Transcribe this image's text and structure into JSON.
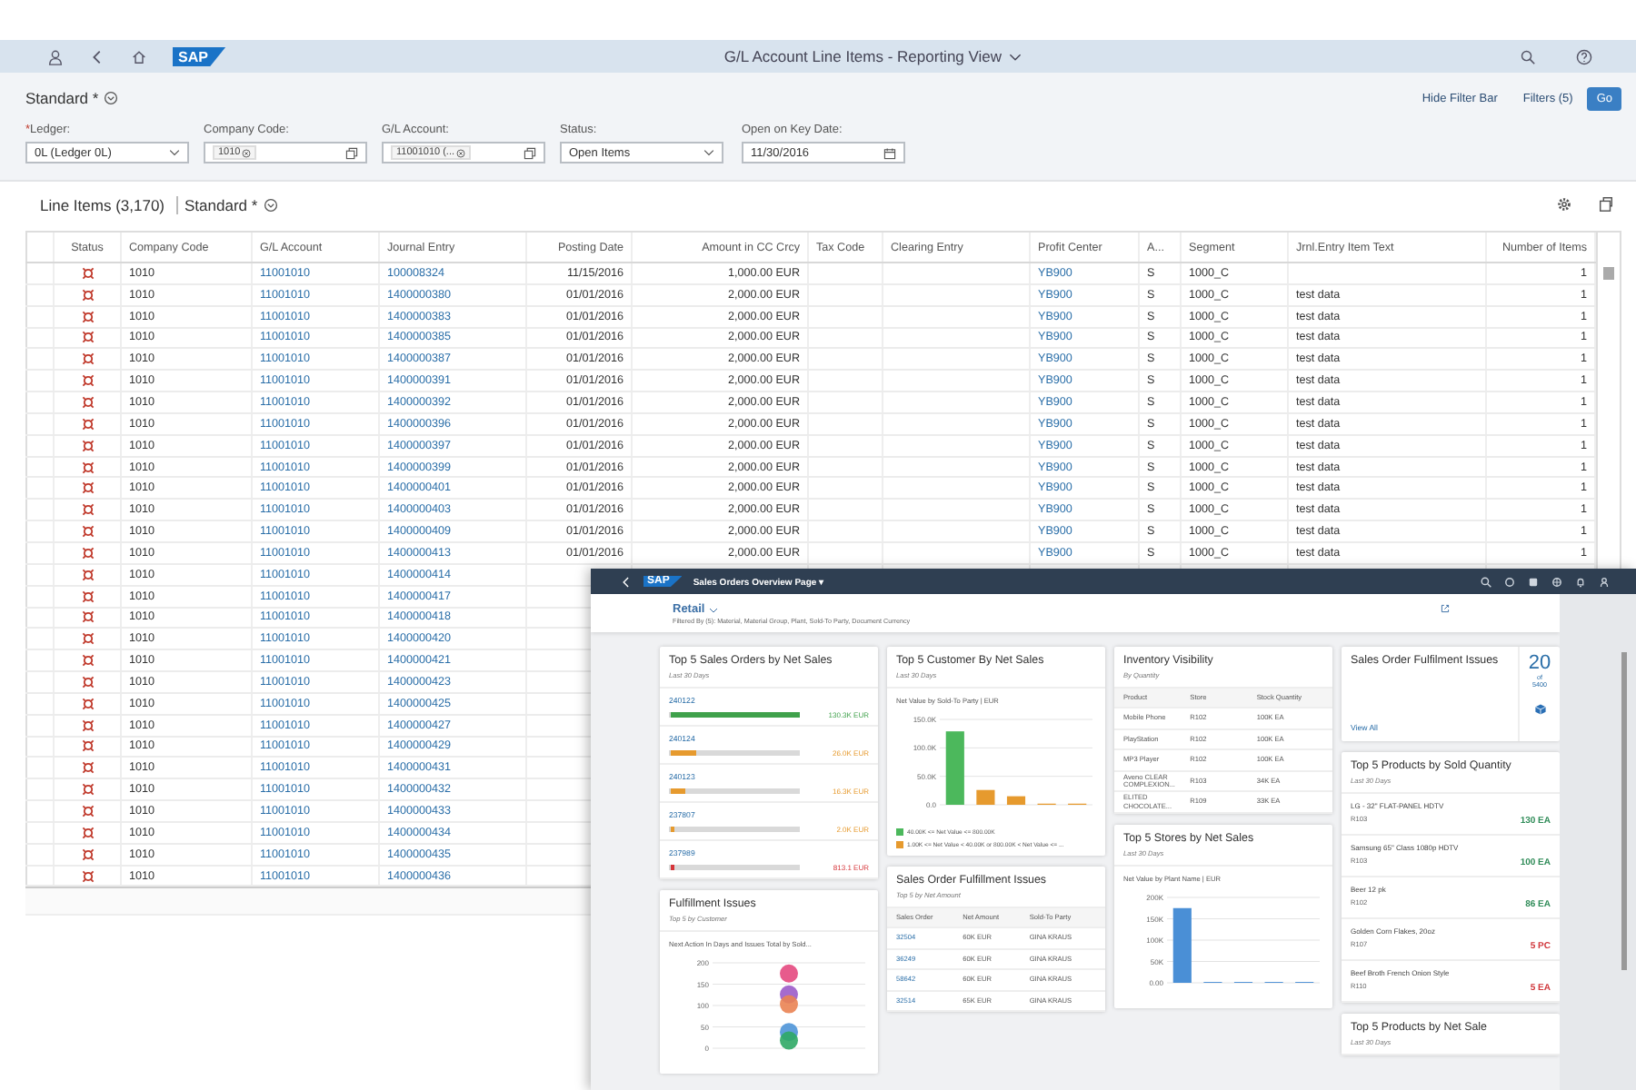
{
  "shell": {
    "logo": "SAP",
    "title": "G/L Account Line Items - Reporting View"
  },
  "filter_bar": {
    "variant": "Standard *",
    "hide_filter_bar": "Hide Filter Bar",
    "filters": "Filters (5)",
    "go": "Go",
    "fields": [
      {
        "label": "Ledger:",
        "required_mark": "*",
        "kind": "select",
        "value": "0L (Ledger 0L)"
      },
      {
        "label": "Company Code:",
        "kind": "tokens",
        "token": "1010"
      },
      {
        "label": "G/L Account:",
        "kind": "tokens",
        "token": "11001010 (..."
      },
      {
        "label": "Status:",
        "kind": "select",
        "value": "Open Items"
      },
      {
        "label": "Open on Key Date:",
        "kind": "date",
        "value": "11/30/2016"
      }
    ]
  },
  "table": {
    "title": "Line Items (3,170)",
    "variant": "Standard *",
    "columns": [
      "Status",
      "Company Code",
      "G/L Account",
      "Journal Entry",
      "Posting Date",
      "Amount in CC Crcy",
      "Tax Code",
      "Clearing Entry",
      "Profit Center",
      "A...",
      "Segment",
      "Jrnl.Entry Item Text",
      "Number of Items"
    ],
    "rows": [
      {
        "company_code": "1010",
        "gl_account": "11001010",
        "journal_entry": "100008324",
        "posting_date": "11/15/2016",
        "amount": "1,000.00 EUR",
        "profit_center": "YB900",
        "account_type": "S",
        "segment": "1000_C",
        "number_of_items": "1"
      },
      {
        "company_code": "1010",
        "gl_account": "11001010",
        "journal_entry": "1400000380",
        "posting_date": "01/01/2016",
        "amount": "2,000.00 EUR",
        "profit_center": "YB900",
        "account_type": "S",
        "segment": "1000_C",
        "item_text": "test data",
        "number_of_items": "1"
      },
      {
        "company_code": "1010",
        "gl_account": "11001010",
        "journal_entry": "1400000383",
        "posting_date": "01/01/2016",
        "amount": "2,000.00 EUR",
        "profit_center": "YB900",
        "account_type": "S",
        "segment": "1000_C",
        "item_text": "test data",
        "number_of_items": "1"
      },
      {
        "company_code": "1010",
        "gl_account": "11001010",
        "journal_entry": "1400000385",
        "posting_date": "01/01/2016",
        "amount": "2,000.00 EUR",
        "profit_center": "YB900",
        "account_type": "S",
        "segment": "1000_C",
        "item_text": "test data",
        "number_of_items": "1"
      },
      {
        "company_code": "1010",
        "gl_account": "11001010",
        "journal_entry": "1400000387",
        "posting_date": "01/01/2016",
        "amount": "2,000.00 EUR",
        "profit_center": "YB900",
        "account_type": "S",
        "segment": "1000_C",
        "item_text": "test data",
        "number_of_items": "1"
      },
      {
        "company_code": "1010",
        "gl_account": "11001010",
        "journal_entry": "1400000391",
        "posting_date": "01/01/2016",
        "amount": "2,000.00 EUR",
        "profit_center": "YB900",
        "account_type": "S",
        "segment": "1000_C",
        "item_text": "test data",
        "number_of_items": "1"
      },
      {
        "company_code": "1010",
        "gl_account": "11001010",
        "journal_entry": "1400000392",
        "posting_date": "01/01/2016",
        "amount": "2,000.00 EUR",
        "profit_center": "YB900",
        "account_type": "S",
        "segment": "1000_C",
        "item_text": "test data",
        "number_of_items": "1"
      },
      {
        "company_code": "1010",
        "gl_account": "11001010",
        "journal_entry": "1400000396",
        "posting_date": "01/01/2016",
        "amount": "2,000.00 EUR",
        "profit_center": "YB900",
        "account_type": "S",
        "segment": "1000_C",
        "item_text": "test data",
        "number_of_items": "1"
      },
      {
        "company_code": "1010",
        "gl_account": "11001010",
        "journal_entry": "1400000397",
        "posting_date": "01/01/2016",
        "amount": "2,000.00 EUR",
        "profit_center": "YB900",
        "account_type": "S",
        "segment": "1000_C",
        "item_text": "test data",
        "number_of_items": "1"
      },
      {
        "company_code": "1010",
        "gl_account": "11001010",
        "journal_entry": "1400000399",
        "posting_date": "01/01/2016",
        "amount": "2,000.00 EUR",
        "profit_center": "YB900",
        "account_type": "S",
        "segment": "1000_C",
        "item_text": "test data",
        "number_of_items": "1"
      },
      {
        "company_code": "1010",
        "gl_account": "11001010",
        "journal_entry": "1400000401",
        "posting_date": "01/01/2016",
        "amount": "2,000.00 EUR",
        "profit_center": "YB900",
        "account_type": "S",
        "segment": "1000_C",
        "item_text": "test data",
        "number_of_items": "1"
      },
      {
        "company_code": "1010",
        "gl_account": "11001010",
        "journal_entry": "1400000403",
        "posting_date": "01/01/2016",
        "amount": "2,000.00 EUR",
        "profit_center": "YB900",
        "account_type": "S",
        "segment": "1000_C",
        "item_text": "test data",
        "number_of_items": "1"
      },
      {
        "company_code": "1010",
        "gl_account": "11001010",
        "journal_entry": "1400000409",
        "posting_date": "01/01/2016",
        "amount": "2,000.00 EUR",
        "profit_center": "YB900",
        "account_type": "S",
        "segment": "1000_C",
        "item_text": "test data",
        "number_of_items": "1"
      },
      {
        "company_code": "1010",
        "gl_account": "11001010",
        "journal_entry": "1400000413",
        "posting_date": "01/01/2016",
        "amount": "2,000.00 EUR",
        "profit_center": "YB900",
        "account_type": "S",
        "segment": "1000_C",
        "item_text": "test data",
        "number_of_items": "1"
      },
      {
        "company_code": "1010",
        "gl_account": "11001010",
        "journal_entry": "1400000414"
      },
      {
        "company_code": "1010",
        "gl_account": "11001010",
        "journal_entry": "1400000417"
      },
      {
        "company_code": "1010",
        "gl_account": "11001010",
        "journal_entry": "1400000418"
      },
      {
        "company_code": "1010",
        "gl_account": "11001010",
        "journal_entry": "1400000420"
      },
      {
        "company_code": "1010",
        "gl_account": "11001010",
        "journal_entry": "1400000421"
      },
      {
        "company_code": "1010",
        "gl_account": "11001010",
        "journal_entry": "1400000423"
      },
      {
        "company_code": "1010",
        "gl_account": "11001010",
        "journal_entry": "1400000425"
      },
      {
        "company_code": "1010",
        "gl_account": "11001010",
        "journal_entry": "1400000427"
      },
      {
        "company_code": "1010",
        "gl_account": "11001010",
        "journal_entry": "1400000429"
      },
      {
        "company_code": "1010",
        "gl_account": "11001010",
        "journal_entry": "1400000431"
      },
      {
        "company_code": "1010",
        "gl_account": "11001010",
        "journal_entry": "1400000432"
      },
      {
        "company_code": "1010",
        "gl_account": "11001010",
        "journal_entry": "1400000433"
      },
      {
        "company_code": "1010",
        "gl_account": "11001010",
        "journal_entry": "1400000434"
      },
      {
        "company_code": "1010",
        "gl_account": "11001010",
        "journal_entry": "1400000435"
      },
      {
        "company_code": "1010",
        "gl_account": "11001010",
        "journal_entry": "1400000436"
      }
    ]
  },
  "overlay": {
    "logo": "SAP",
    "app_title": "Sales Orders Overview Page ▾",
    "header_title": "Retail",
    "filter_summary": "Filtered By (5): Material, Material Group, Plant, Sold-To Party, Document Currency",
    "columns": [
      [
        {
          "kind": "bar_list",
          "title": "Top 5 Sales Orders by Net Sales",
          "subtitle": "Last 30 Days",
          "items": [
            {
              "label": "240122",
              "value": "130.3K EUR",
              "level": 1,
              "color": "#3fa14b"
            },
            {
              "label": "240124",
              "value": "26.0K EUR",
              "level": 0.2,
              "color": "#e69a2e"
            },
            {
              "label": "240123",
              "value": "16.3K EUR",
              "level": 0.12,
              "color": "#e69a2e"
            },
            {
              "label": "237807",
              "value": "2.0K EUR",
              "level": 0.02,
              "color": "#e69a2e"
            },
            {
              "label": "237989",
              "value": "813.1 EUR",
              "level": 0.01,
              "color": "#d6353a"
            }
          ]
        },
        {
          "kind": "chart",
          "title": "Fulfillment Issues",
          "subtitle": "Top 5 by Customer",
          "chart_data": {
            "type": "scatter",
            "title": "Next Action In Days and Issues Total by Sold...",
            "grid": true,
            "ylim": [
              0,
              200
            ],
            "yticks": [
              0,
              50,
              100,
              150,
              200
            ],
            "series": [
              {
                "color": "#e4497f",
                "values": [
                  175
                ]
              },
              {
                "color": "#9b5bc9",
                "values": [
                  126
                ]
              },
              {
                "color": "#ea8353",
                "values": [
                  103
                ]
              },
              {
                "color": "#4f95d8",
                "values": [
                  38
                ]
              },
              {
                "color": "#2fa865",
                "values": [
                  18
                ]
              }
            ]
          }
        }
      ],
      [
        {
          "kind": "chart",
          "title": "Top 5 Customer By Net Sales",
          "subtitle": "Last 30 Days",
          "chart_data": {
            "type": "bar",
            "title": "Net Value by Sold-To Party | EUR",
            "grid": true,
            "ylim": [
              0,
              150000
            ],
            "yticks": [
              {
                "value": 0,
                "label": "0.0"
              },
              {
                "value": 50000,
                "label": "50.0K"
              },
              {
                "value": 100000,
                "label": "100.0K"
              },
              {
                "value": 150000,
                "label": "150.0K"
              }
            ],
            "series": [
              {
                "name": "40.00K <= Net Value <= 800.00K",
                "color": "#4cb85c",
                "values": [
                  129000,
                  null,
                  null,
                  null,
                  null
                ]
              },
              {
                "name": "1.00K <= Net Value < 40.00K or 800.00K < Net Value <= ...",
                "color": "#e69a2e",
                "values": [
                  null,
                  26000,
                  15000,
                  2000,
                  2000
                ]
              }
            ]
          }
        },
        {
          "kind": "table",
          "title": "Sales Order Fulfillment Issues",
          "subtitle": "Top 5 by Net Amount",
          "links": true,
          "columns": [
            "Sales Order",
            "Net Amount",
            "Sold-To Party"
          ],
          "rows": [
            [
              "32504",
              "60K EUR",
              "GINA KRAUS"
            ],
            [
              "36249",
              "60K EUR",
              "GINA KRAUS"
            ],
            [
              "58642",
              "60K EUR",
              "GINA KRAUS"
            ],
            [
              "32514",
              "65K EUR",
              "GINA KRAUS"
            ]
          ]
        }
      ],
      [
        {
          "kind": "table",
          "title": "Inventory Visibility",
          "subtitle": "By Quantity",
          "links": false,
          "columns": [
            "Product",
            "Store",
            "Stock Quantity"
          ],
          "rows": [
            [
              "Mobile Phone",
              "R102",
              "100K EA"
            ],
            [
              "PlayStation",
              "R102",
              "100K EA"
            ],
            [
              "MP3 Player",
              "R102",
              "100K EA"
            ],
            [
              "Aveno CLEAR COMPLEXION...",
              "R103",
              "34K EA"
            ],
            [
              "ELITED CHOCOLATE...",
              "R109",
              "33K EA"
            ]
          ]
        },
        {
          "kind": "chart",
          "title": "Top 5 Stores by Net Sales",
          "subtitle": "Last 30 Days",
          "chart_data": {
            "type": "bar",
            "title": "Net Value by Plant Name | EUR",
            "grid": true,
            "ylim": [
              0,
              200000
            ],
            "yticks": [
              {
                "value": 0,
                "label": "0.00"
              },
              {
                "value": 50000,
                "label": "50K"
              },
              {
                "value": 100000,
                "label": "100K"
              },
              {
                "value": 150000,
                "label": "150K"
              },
              {
                "value": 200000,
                "label": "200K"
              }
            ],
            "series": [
              {
                "color": "#4a8fd6",
                "values": [
                  175000,
                  2000,
                  2000,
                  2000,
                  2000
                ]
              }
            ]
          }
        }
      ],
      [
        {
          "kind": "kpi",
          "title": "Sales Order Fulfilment Issues",
          "value": "20",
          "of": "of",
          "total": "5400",
          "link": "View All"
        },
        {
          "kind": "product_list",
          "title": "Top 5 Products by Sold Quantity",
          "subtitle": "Last 30 Days",
          "items": [
            {
              "name": "LG - 32\" FLAT-PANEL HDTV",
              "store": "R103",
              "quantity": "130 EA",
              "color": "#2e8b57"
            },
            {
              "name": "Samsung 65\" Class 1080p HDTV",
              "store": "R103",
              "quantity": "100 EA",
              "color": "#2e8b57"
            },
            {
              "name": "Beer 12 pk",
              "store": "R102",
              "quantity": "86 EA",
              "color": "#2e8b57"
            },
            {
              "name": "Golden Corn Flakes, 20oz",
              "store": "R107",
              "quantity": "5 PC",
              "color": "#d0363b"
            },
            {
              "name": "Beef Broth French Onion Style",
              "store": "R110",
              "quantity": "5 EA",
              "color": "#d0363b"
            }
          ]
        },
        {
          "kind": "product_list",
          "title": "Top 5 Products by Net Sale",
          "subtitle": "Last 30 Days"
        }
      ]
    ]
  }
}
